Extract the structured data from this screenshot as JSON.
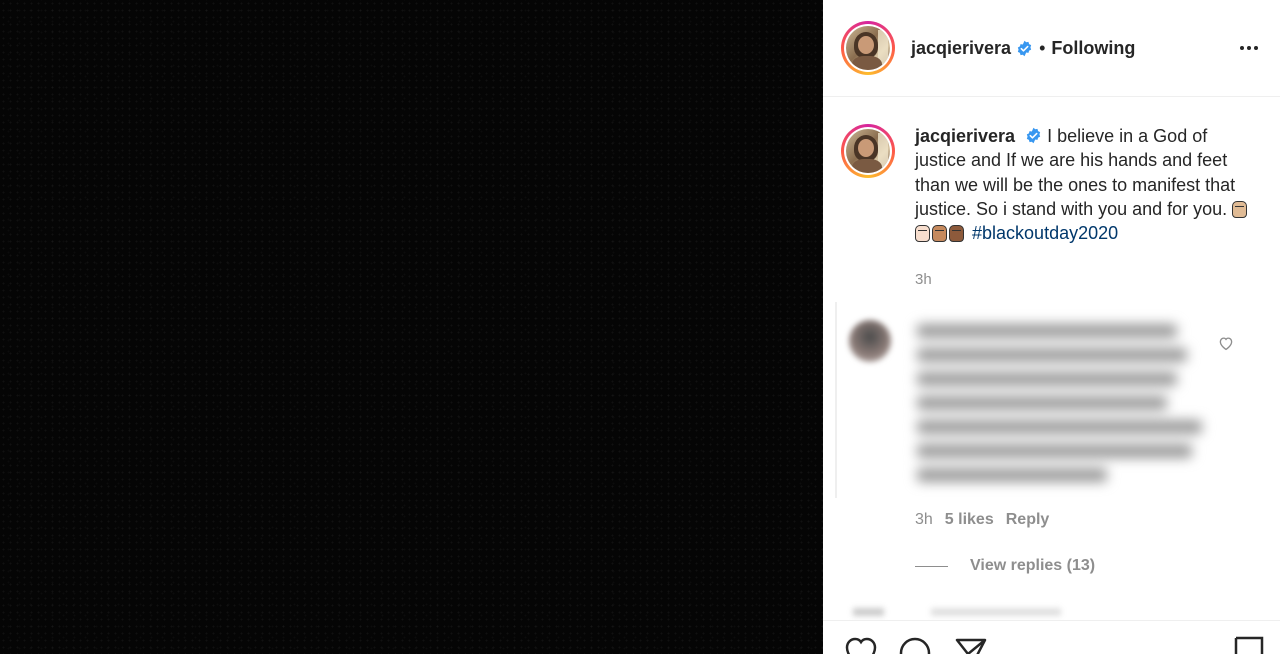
{
  "post": {
    "author": {
      "username": "jacqierivera",
      "verified": true,
      "avatar_icon": "profile-photo",
      "follow_status": "Following",
      "separator": "•"
    },
    "caption": {
      "username": "jacqierivera",
      "text": "I believe in a God of justice and If we are his hands and feet than we will be the ones to manifest that justice. So i stand with you and for you.",
      "emojis": [
        "raised-fist-medium-light",
        "raised-fist-light",
        "raised-fist-medium",
        "raised-fist-medium-dark"
      ],
      "hashtag": "#blackoutday2020",
      "time": "3h"
    },
    "comment": {
      "blurred": true,
      "time": "3h",
      "likes": "5 likes",
      "reply_label": "Reply",
      "view_replies": "View replies (13)"
    }
  },
  "icons": {
    "more": "more-options-icon",
    "verified": "verified-badge-icon",
    "comment_like": "heart-outline-icon",
    "like": "heart-icon",
    "comment": "comment-bubble-icon",
    "share": "paper-plane-icon",
    "save": "bookmark-icon"
  },
  "colors": {
    "verified_blue": "#3897f0",
    "hashtag": "#00376b",
    "muted_text": "#8e8e8e",
    "text": "#262626"
  }
}
